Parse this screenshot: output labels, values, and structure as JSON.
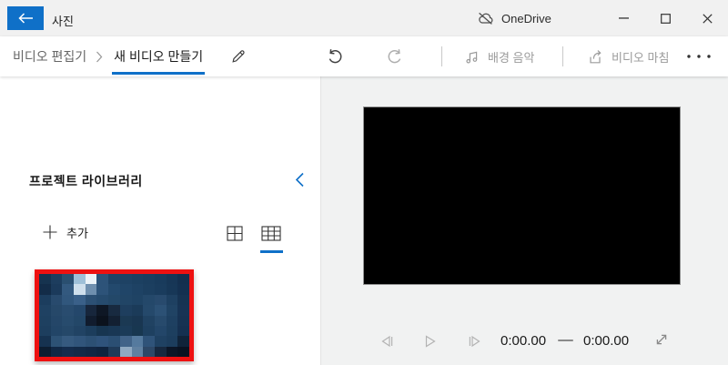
{
  "titlebar": {
    "app_title": "사진",
    "onedrive_label": "OneDrive"
  },
  "toolbar": {
    "breadcrumb_root": "비디오 편집기",
    "breadcrumb_current": "새 비디오 만들기",
    "background_music_label": "배경 음악",
    "finish_video_label": "비디오 마침"
  },
  "library": {
    "title": "프로젝트 라이브러리",
    "add_label": "추가",
    "thumbnail_pixels": [
      [
        "#16334f",
        "#1d3d5e",
        "#2a4f70",
        "#9fc0d8",
        "#ecf3f8",
        "#2d5379",
        "#1f4366",
        "#1e4264",
        "#1c4061",
        "#1b3e5f",
        "#193b5c",
        "#173656",
        "#142f4e"
      ],
      [
        "#132c48",
        "#1b3a5b",
        "#33597f",
        "#cfdfec",
        "#6f8fae",
        "#2d5379",
        "#23496d",
        "#204568",
        "#1e4264",
        "#1c3f60",
        "#1a3c5d",
        "#173757",
        "#143050"
      ],
      [
        "#1c3d5e",
        "#284a6d",
        "#31577d",
        "#3a6089",
        "#2c5074",
        "#264b6e",
        "#234869",
        "#214566",
        "#1f4364",
        "#24486a",
        "#284a6d",
        "#1e4061",
        "#163352"
      ],
      [
        "#1f4162",
        "#264869",
        "#294c6f",
        "#24476b",
        "#17263c",
        "#0e1725",
        "#182a40",
        "#1e3e5e",
        "#1b3b59",
        "#25496b",
        "#2c5175",
        "#204364",
        "#173354"
      ],
      [
        "#1e4060",
        "#244668",
        "#274b6d",
        "#234768",
        "#111c2e",
        "#0b121d",
        "#132032",
        "#1b3953",
        "#193651",
        "#204262",
        "#274a6c",
        "#1e4061",
        "#163252"
      ],
      [
        "#1d3e5e",
        "#224567",
        "#254869",
        "#214364",
        "#1c3d5c",
        "#173550",
        "#193754",
        "#1b3b58",
        "#183750",
        "#1e4060",
        "#234669",
        "#1d3f5f",
        "#153050"
      ],
      [
        "#163250",
        "#2d5275",
        "#365a7f",
        "#31557b",
        "#2c5074",
        "#2f537b",
        "#2b4f73",
        "#416388",
        "#557a9e",
        "#2f5379",
        "#1f4162",
        "#1c3d5d",
        "#102339"
      ],
      [
        "#0d1d31",
        "#112845",
        "#142c4d",
        "#132a48",
        "#122744",
        "#10243f",
        "#203b59",
        "#90a9c1",
        "#6081a1",
        "#2d4867",
        "#17283f",
        "#0c1627",
        "#091221"
      ]
    ]
  },
  "player": {
    "current_time": "0:00.00",
    "total_time": "0:00.00"
  },
  "colors": {
    "accent": "#0f70c8",
    "selection-red": "#ee1111",
    "titlebar-bg": "#f1f1f1",
    "panel-bg": "#f1f2f2"
  },
  "icons": {
    "back-icon": "←",
    "onedrive-cloud-icon": "cloud-with-slash",
    "minimize-icon": "—",
    "maximize-icon": "□",
    "close-icon": "✕",
    "breadcrumb-chevron-icon": "›",
    "rename-pencil-icon": "✎",
    "undo-icon": "↶",
    "redo-icon": "↷",
    "music-note-icon": "♫",
    "share-icon": "box-with-arrow",
    "more-icon": "⋯",
    "collapse-chevron-icon": "‹",
    "add-plus-icon": "+",
    "grid-large-icon": "2x2-grid",
    "grid-small-icon": "3x3-grid",
    "prev-frame-icon": "◁|",
    "play-icon": "▷",
    "next-frame-icon": "|▷",
    "fullscreen-icon": "⤢",
    "duration-dash-icon": "—"
  }
}
